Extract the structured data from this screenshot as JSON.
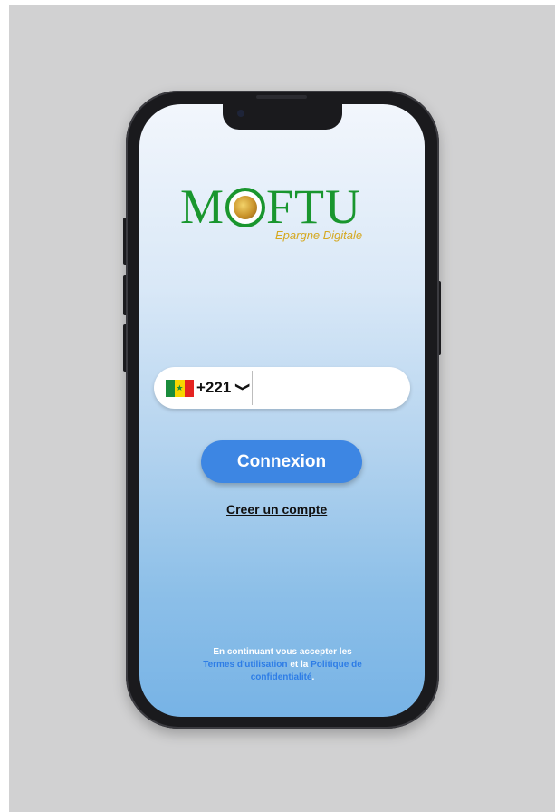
{
  "app": {
    "logo_text_left": "M",
    "logo_text_right": "FTU",
    "tagline": "Epargne Digitale"
  },
  "login": {
    "country_code": "+221",
    "country_flag": "senegal-flag",
    "phone_value": "",
    "connect_label": "Connexion",
    "create_account_label": "Creer un compte"
  },
  "legal": {
    "prefix": "En continuant vous accepter les",
    "terms_label": "Termes d'utilisation",
    "joiner": "et la",
    "privacy_label": "Politique de confidentialité",
    "suffix": "."
  },
  "colors": {
    "brand_green": "#19962e",
    "tagline_gold": "#d5a820",
    "button_blue": "#3d86e3",
    "link_blue": "#2e7de6"
  }
}
